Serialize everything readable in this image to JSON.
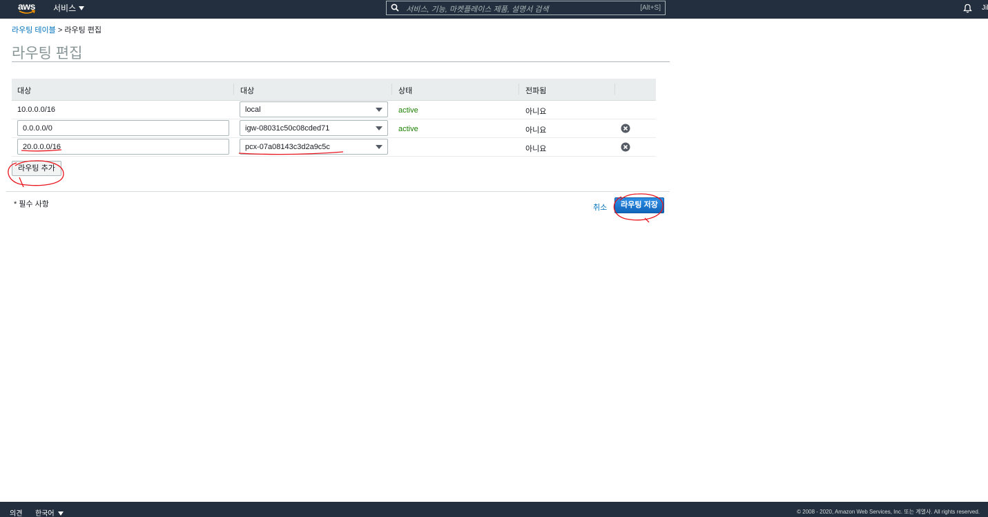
{
  "header": {
    "logo_text": "aws",
    "services_label": "서비스",
    "search_placeholder": "서비스, 기능, 마켓플레이스 제품, 설명서 검색",
    "search_shortcut": "[Alt+S]",
    "user_text": "Jil"
  },
  "breadcrumb": {
    "parent": "라우팅 테이블",
    "separator": ">",
    "current": "라우팅 편집"
  },
  "page_title": "라우팅 편집",
  "table": {
    "headers": [
      "대상",
      "대상",
      "상태",
      "전파됨"
    ],
    "rows": [
      {
        "destination": "10.0.0.0/16",
        "target": "local",
        "status": "active",
        "propagated": "아니요"
      },
      {
        "destination": "0.0.0.0/0",
        "target": "igw-08031c50c08cded71",
        "status": "active",
        "propagated": "아니요"
      },
      {
        "destination": "20.0.0.0/16",
        "target": "pcx-07a08143c3d2a9c5c",
        "status": "",
        "propagated": "아니요"
      }
    ]
  },
  "actions": {
    "add_route": "라우팅 추가",
    "required_note": "* 필수 사항",
    "cancel": "취소",
    "save": "라우팅 저장"
  },
  "footer": {
    "feedback": "의견",
    "language": "한국어",
    "copyright": "© 2008 - 2020, Amazon Web Services, Inc. 또는 계열사. All rights reserved."
  },
  "colors": {
    "nav_bg": "#232f3e",
    "link": "#0073bb",
    "active_status": "#1d8102",
    "primary_button": "#1166bb",
    "annotation": "#e8141c"
  }
}
